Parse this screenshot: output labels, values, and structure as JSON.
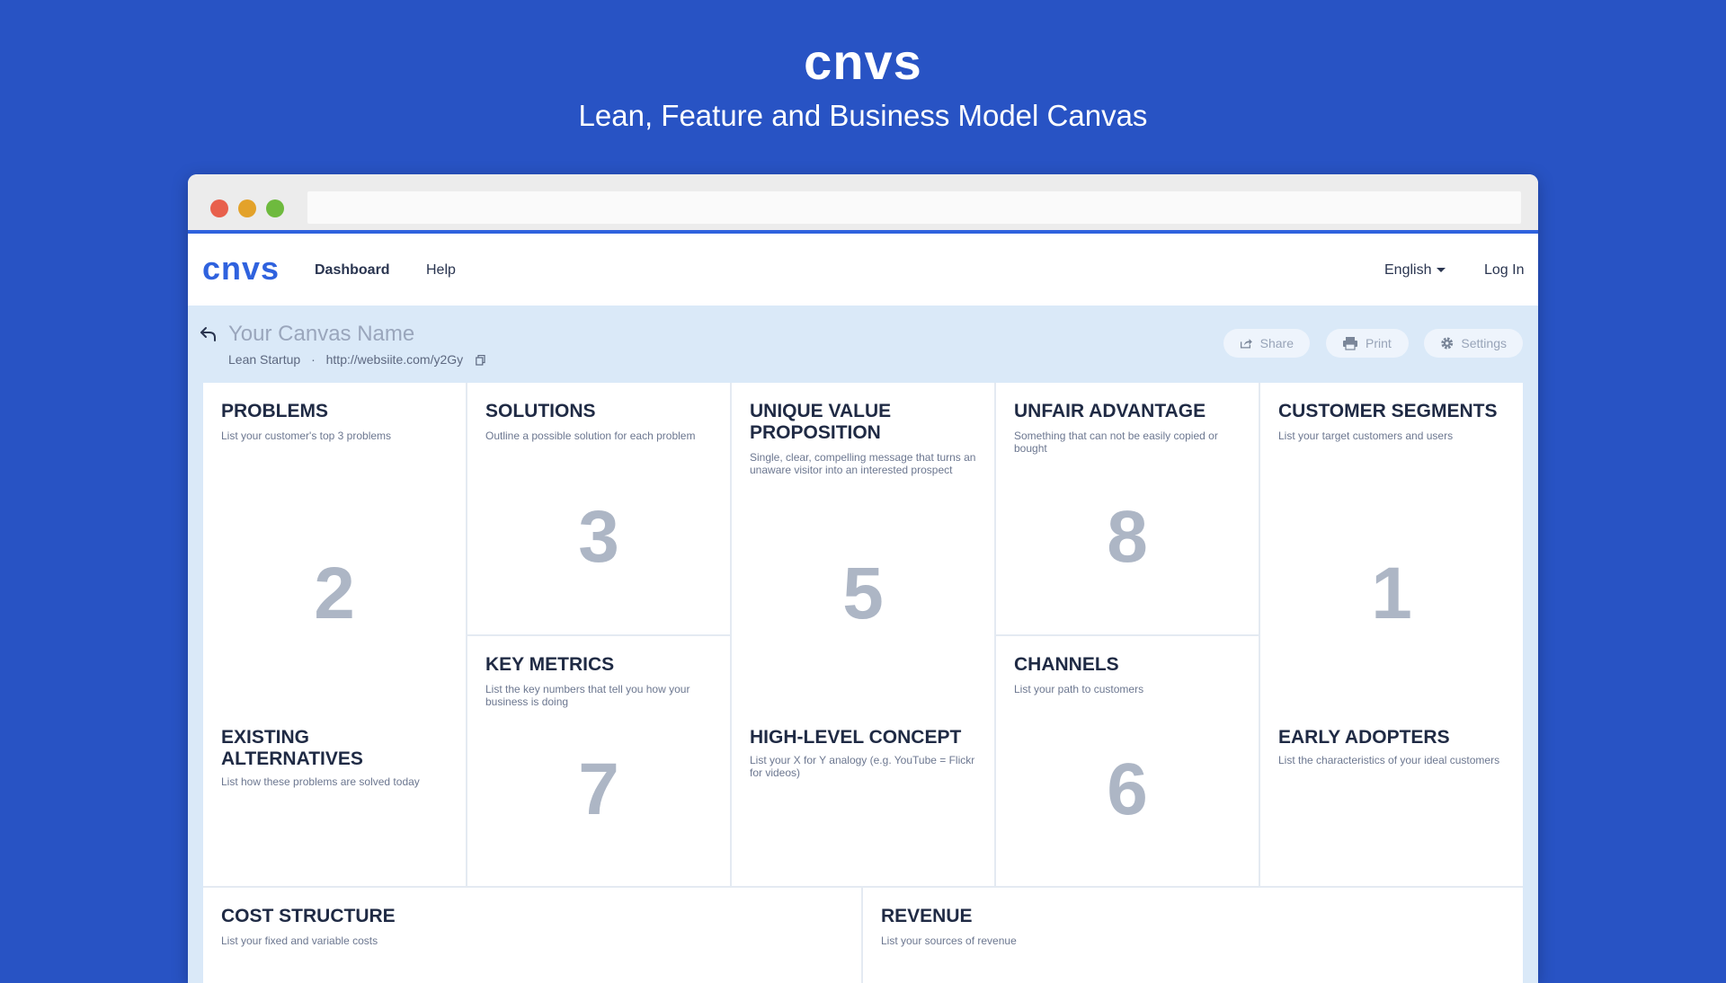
{
  "hero": {
    "logo": "cnvs",
    "tagline": "Lean, Feature and Business Model Canvas"
  },
  "navbar": {
    "logo": "cnvs",
    "links": [
      "Dashboard",
      "Help"
    ],
    "language": "English",
    "login": "Log In"
  },
  "canvas": {
    "name_placeholder": "Your Canvas Name",
    "type": "Lean Startup",
    "separator": "·",
    "url": "http://websiite.com/y2Gy",
    "actions": {
      "share": "Share",
      "print": "Print",
      "settings": "Settings"
    }
  },
  "blocks": {
    "problems": {
      "title": "PROBLEMS",
      "desc": "List your customer's top 3 problems",
      "number": "2"
    },
    "existing_alternatives": {
      "title": "EXISTING ALTERNATIVES",
      "desc": "List how these problems are solved today"
    },
    "solutions": {
      "title": "SOLUTIONS",
      "desc": "Outline a possible solution for each problem",
      "number": "3"
    },
    "key_metrics": {
      "title": "KEY METRICS",
      "desc": "List the key numbers that tell you how your business is doing",
      "number": "7"
    },
    "uvp": {
      "title": "UNIQUE VALUE PROPOSITION",
      "desc": "Single, clear, compelling message that turns an unaware visitor into an interested prospect",
      "number": "5"
    },
    "high_level_concept": {
      "title": "HIGH-LEVEL CONCEPT",
      "desc": "List your X for Y analogy (e.g. YouTube = Flickr for videos)"
    },
    "unfair_advantage": {
      "title": "UNFAIR ADVANTAGE",
      "desc": "Something that can not be easily copied or bought",
      "number": "8"
    },
    "channels": {
      "title": "CHANNELS",
      "desc": "List your path to customers",
      "number": "6"
    },
    "customer_segments": {
      "title": "CUSTOMER SEGMENTS",
      "desc": "List your target customers and users",
      "number": "1"
    },
    "early_adopters": {
      "title": "EARLY ADOPTERS",
      "desc": "List the characteristics of your ideal customers"
    },
    "cost_structure": {
      "title": "COST STRUCTURE",
      "desc": "List your fixed and variable costs"
    },
    "revenue": {
      "title": "REVENUE",
      "desc": "List your sources of revenue"
    }
  },
  "colors": {
    "background": "#2853C4",
    "accent": "#2F62DE",
    "canvas_bg": "#DAE9F8"
  },
  "icons": [
    "back-arrow-icon",
    "copy-icon",
    "share-icon",
    "print-icon",
    "gear-icon",
    "caret-down-icon"
  ]
}
